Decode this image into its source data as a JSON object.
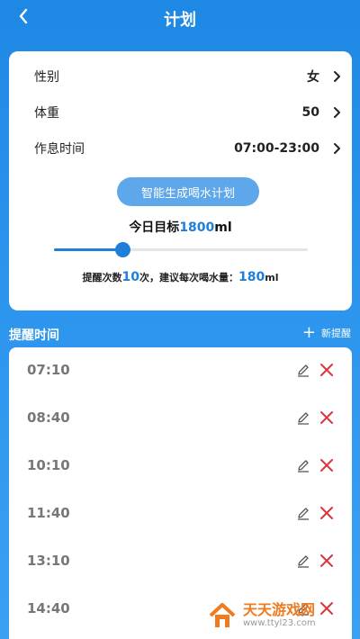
{
  "header": {
    "title": "计划"
  },
  "settings": [
    {
      "label": "性别",
      "value": "女"
    },
    {
      "label": "体重",
      "value": "50"
    },
    {
      "label": "作息时间",
      "value": "07:00-23:00"
    }
  ],
  "generate_button": "智能生成喝水计划",
  "goal": {
    "prefix": "今日目标",
    "amount": "1800",
    "unit": "ml"
  },
  "slider": {
    "level": 0.27
  },
  "advice": {
    "prefix": "提醒次数",
    "count": "10",
    "middle": "次，建议每次喝水量：",
    "amount": "180",
    "unit": "ml"
  },
  "reminders_section": {
    "title": "提醒时间",
    "add_label": "新提醒"
  },
  "reminders": [
    "07:10",
    "08:40",
    "10:10",
    "11:40",
    "13:10",
    "14:40"
  ],
  "watermark": {
    "title": "天天游戏网",
    "url": "www.ttyl23.com"
  },
  "colors": {
    "primary": "#1e7fd8",
    "delete": "#d9363e",
    "button": "#5da7ea"
  }
}
